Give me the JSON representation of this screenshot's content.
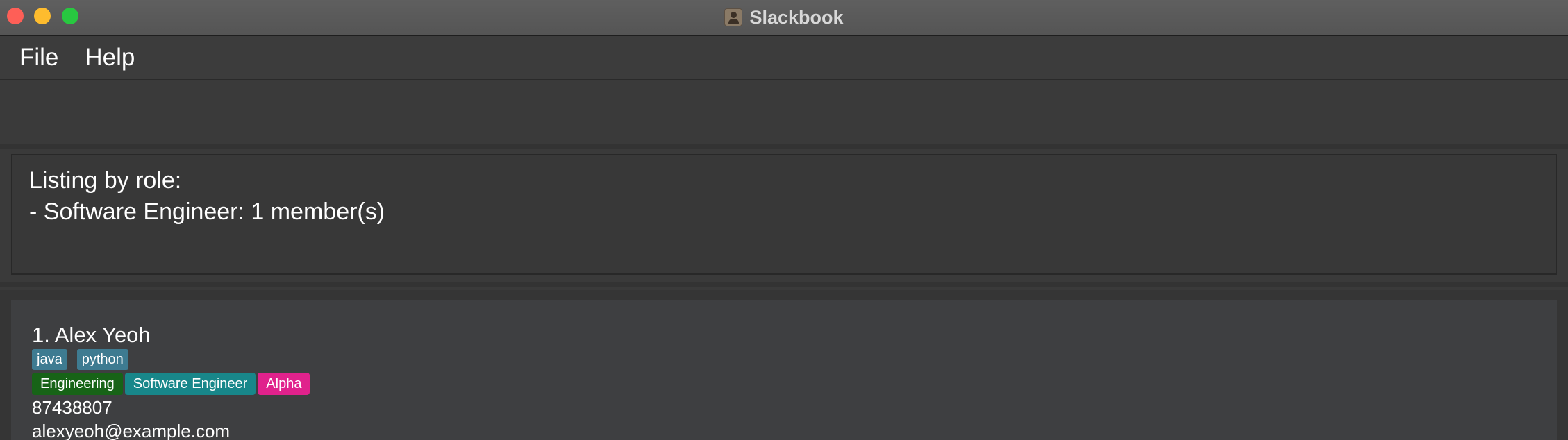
{
  "window": {
    "title": "Slackbook",
    "controls": [
      "close",
      "minimize",
      "maximize"
    ]
  },
  "menu": {
    "items": [
      "File",
      "Help"
    ]
  },
  "command": {
    "value": "",
    "placeholder": ""
  },
  "result": {
    "lines": [
      "Listing by role:",
      "- Software Engineer: 1 member(s)"
    ]
  },
  "people": [
    {
      "index_name": "1. Alex Yeoh",
      "tags": [
        "java",
        "python"
      ],
      "groups": [
        {
          "label": "Engineering",
          "color": "#176317"
        },
        {
          "label": "Software Engineer",
          "color": "#18878a"
        },
        {
          "label": "Alpha",
          "color": "#e0228c"
        }
      ],
      "phone": "87438807",
      "email": "alexyeoh@example.com"
    }
  ],
  "colors": {
    "background": "#3a3a3a",
    "titlebar": "#5a5a5a",
    "tag": "#3e7b91",
    "card": "#3e3f41"
  },
  "icons": {
    "app": "contacts-book-icon"
  }
}
